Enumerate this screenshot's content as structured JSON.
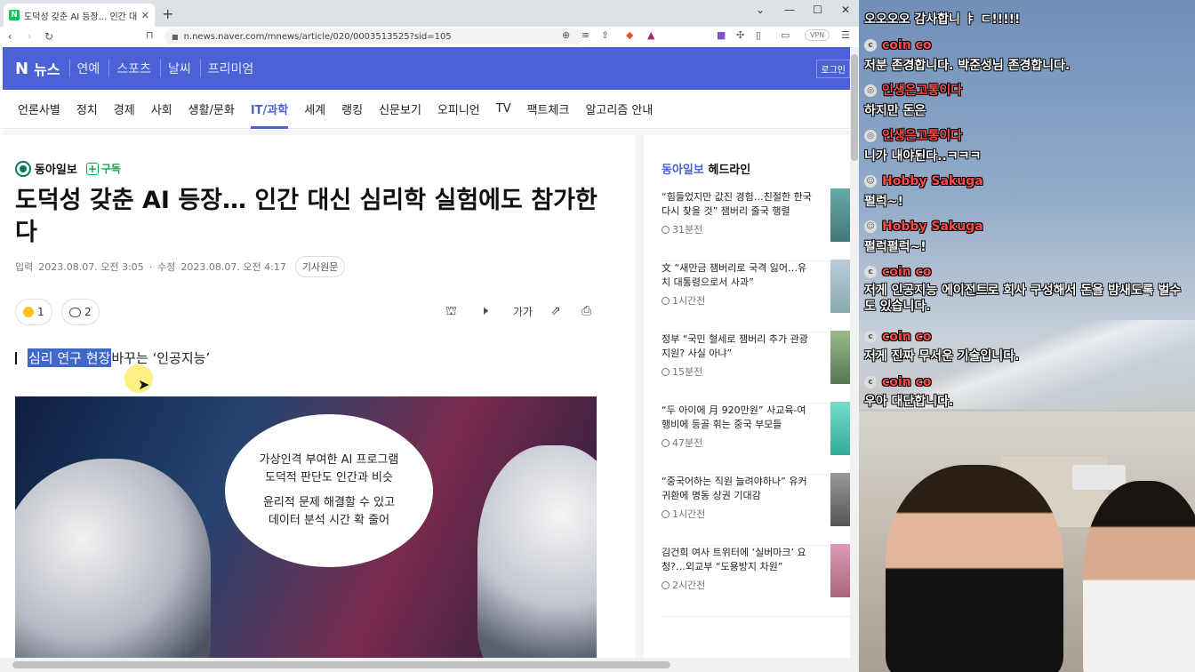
{
  "browser": {
    "tab_title": "도덕성 갖춘 AI 등장... 인간 대신",
    "tab_favicon": "N",
    "url": "n.news.naver.com/mnews/article/020/0003513525?sid=105",
    "vpn": "VPN"
  },
  "naver": {
    "logo": "N",
    "news": "뉴스",
    "links": [
      "연예",
      "스포츠",
      "날씨",
      "프리미엄"
    ],
    "login": "로그인",
    "menu": [
      "언론사별",
      "정치",
      "경제",
      "사회",
      "생활/문화",
      "IT/과학",
      "세계",
      "랭킹",
      "신문보기",
      "오피니언",
      "TV",
      "팩트체크",
      "알고리즘 안내"
    ],
    "active_menu": "IT/과학",
    "accent": "#4a62d6"
  },
  "article": {
    "press": "동아일보",
    "subscribe": "구독",
    "headline": "도덕성 갖춘 AI 등장… 인간 대신 심리학 실험에도 참가한다",
    "input_label": "입력",
    "input_date": "2023.08.07. 오전 3:05",
    "modify_label": "수정",
    "modify_date": "2023.08.07. 오전 4:17",
    "original_btn": "기사원문",
    "reaction_count": "1",
    "comment_count": "2",
    "font_icon": "가가",
    "subhead_highlight": "심리 연구 현장",
    "subhead_rest": " 바꾸는 ‘인공지능’",
    "bubble_lines": [
      "가상인격 부여한 AI 프로그램",
      "도덕적 판단도 인간과 비슷",
      "윤리적 문제 해결할 수 있고",
      "데이터 분석 시간 확 줄어"
    ]
  },
  "sidebar": {
    "brand": "동아일보",
    "title": "헤드라인",
    "items": [
      {
        "text": "“힘들었지만 값진 경험…친절한 한국 다시 찾을 것” 잼버리 줄국 행렬",
        "time": "31분전"
      },
      {
        "text": "文 “새만금 잼버리로 국격 잃어…유치 대통령으로서 사과”",
        "time": "1시간전"
      },
      {
        "text": "정부 “국민 혈세로 잼버리 추가 관광 지원? 사실 아냐”",
        "time": "15분전"
      },
      {
        "text": "“두 아이에 月 920만원” 사교육-여행비에 등골 휘는 중국 부모들",
        "time": "47분전"
      },
      {
        "text": "“중국어하는 직원 늘려야하나” 유커 귀환에 명동 상권 기대감",
        "time": "1시간전"
      },
      {
        "text": "김건희 여사 트위터에 ‘실버마크’ 요청?…외교부 “도용방지 차원”",
        "time": "2시간전"
      }
    ]
  },
  "chat": [
    {
      "name": "",
      "msg": "오오오오 감사합니 ㅑ ㄷ!!!!!"
    },
    {
      "name": "coin co",
      "msg": "저분 존경합니다. 박준성님 존경합니다."
    },
    {
      "name": "인생은고통이다",
      "msg": "하지만 돈은"
    },
    {
      "name": "인생은고통이다",
      "msg": "니가 내야된다..ㅋㅋㅋ"
    },
    {
      "name": "Hobby Sakuga",
      "msg": "펄럭~!"
    },
    {
      "name": "Hobby Sakuga",
      "msg": "펄럭펄럭~!"
    },
    {
      "name": "coin co",
      "msg": "저게 인공지능 에이전트로 회사 구성해서 돈을 밤새도록 벌수도 있습니다."
    },
    {
      "name": "coin co",
      "msg": "저게 진짜 무서운 기술입니다."
    },
    {
      "name": "coin co",
      "msg": "우아 대단합니다."
    }
  ]
}
